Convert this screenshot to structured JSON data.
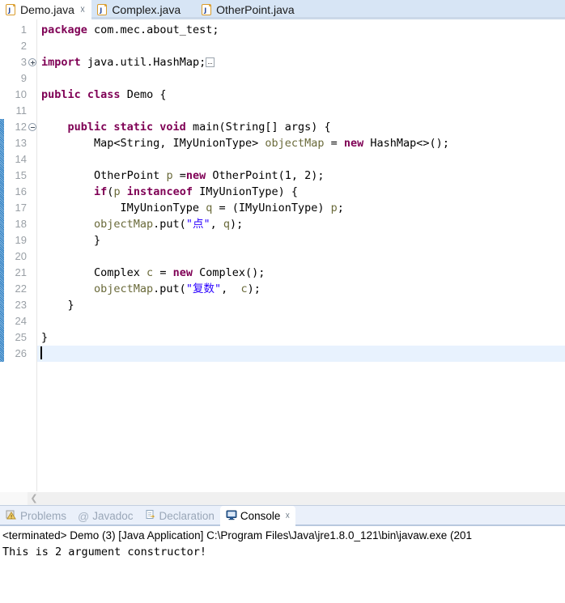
{
  "editor_tabs": [
    {
      "label": "Demo.java",
      "icon": "java-file-icon",
      "active": true,
      "closable": true
    },
    {
      "label": "Complex.java",
      "icon": "java-file-icon",
      "active": false,
      "closable": false
    },
    {
      "label": "OtherPoint.java",
      "icon": "java-file-icon",
      "active": false,
      "closable": false
    }
  ],
  "editor": {
    "line_numbers": [
      "1",
      "2",
      "3",
      "9",
      "10",
      "11",
      "12",
      "13",
      "14",
      "15",
      "16",
      "17",
      "18",
      "19",
      "20",
      "21",
      "22",
      "23",
      "24",
      "25",
      "26"
    ],
    "fold_markers": {
      "3": "collapsed-plus",
      "12": "expanded-minus"
    },
    "change_bar": {
      "from_line": "10",
      "to_line": "25",
      "color": "#2f7fc4"
    },
    "current_line": "26",
    "lines": [
      "package com.mec.about_test;",
      "",
      "import java.util.HashMap;",
      "",
      "public class Demo {",
      "",
      "    public static void main(String[] args) {",
      "        Map<String, IMyUnionType> objectMap = new HashMap<>();",
      "",
      "        OtherPoint p =new OtherPoint(1, 2);",
      "        if(p instanceof IMyUnionType) {",
      "            IMyUnionType q = (IMyUnionType) p;",
      "            objectMap.put(\"点\", q);",
      "        }",
      "",
      "        Complex c = new Complex();",
      "        objectMap.put(\"复数\",  c);",
      "    }",
      "",
      "}",
      ""
    ],
    "scrollbar": {
      "left_arrow": "scroll-left-arrow"
    }
  },
  "view_tabs": [
    {
      "label": "Problems",
      "icon": "problems-icon",
      "active": false,
      "closable": false
    },
    {
      "label": "Javadoc",
      "icon": "javadoc-at-icon",
      "active": false,
      "closable": false
    },
    {
      "label": "Declaration",
      "icon": "declaration-icon",
      "active": false,
      "closable": false
    },
    {
      "label": "Console",
      "icon": "console-icon",
      "active": true,
      "closable": true
    }
  ],
  "console": {
    "header": "<terminated> Demo (3) [Java Application] C:\\Program Files\\Java\\jre1.8.0_121\\bin\\javaw.exe (201",
    "output": "This is 2 argument constructor!"
  },
  "colors": {
    "keyword": "#7f0055",
    "string": "#2a00ff",
    "local_variable": "#6a6a3a",
    "active_tab_bg": "#ffffff",
    "inactive_tab_bg": "#d7e5f5",
    "current_line_bg": "#e8f2fe",
    "change_bar": "#2f7fc4"
  }
}
